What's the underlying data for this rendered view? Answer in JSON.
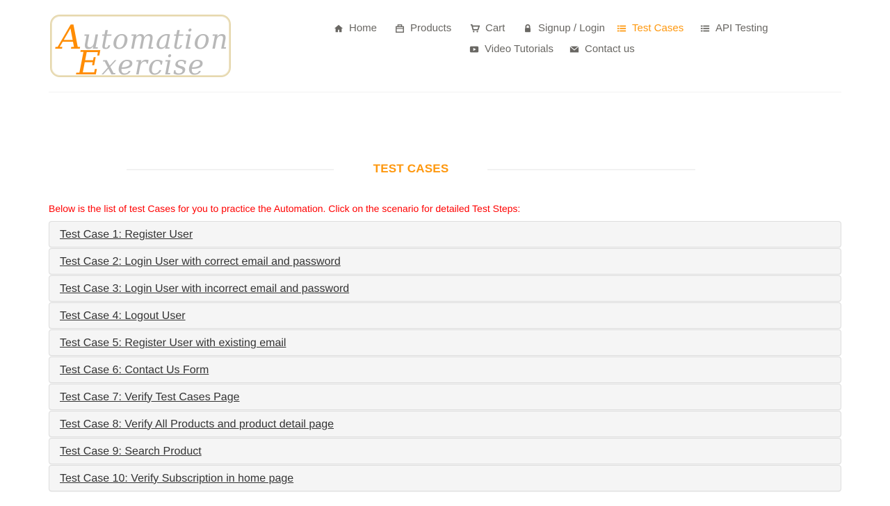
{
  "logo": {
    "line1_first": "A",
    "line1_rest": "utomation",
    "line2_first": "E",
    "line2_rest": "xercise"
  },
  "nav": [
    {
      "label": "Home",
      "icon": "home-icon"
    },
    {
      "label": "Products",
      "icon": "products-icon"
    },
    {
      "label": "Cart",
      "icon": "cart-icon"
    },
    {
      "label": "Signup / Login",
      "icon": "lock-icon"
    },
    {
      "label": "Test Cases",
      "icon": "list-icon",
      "active": true
    },
    {
      "label": "API Testing",
      "icon": "list-icon"
    },
    {
      "label": "Video Tutorials",
      "icon": "youtube-icon"
    },
    {
      "label": "Contact us",
      "icon": "envelope-icon"
    }
  ],
  "page": {
    "title": "TEST CASES",
    "intro": "Below is the list of test Cases for you to practice the Automation. Click on the scenario for detailed Test Steps:"
  },
  "test_cases": [
    "Test Case 1: Register User",
    "Test Case 2: Login User with correct email and password",
    "Test Case 3: Login User with incorrect email and password",
    "Test Case 4: Logout User",
    "Test Case 5: Register User with existing email",
    "Test Case 6: Contact Us Form",
    "Test Case 7: Verify Test Cases Page",
    "Test Case 8: Verify All Products and product detail page",
    "Test Case 9: Search Product",
    "Test Case 10: Verify Subscription in home page"
  ],
  "colors": {
    "accent": "#fe980f",
    "nav_text": "#696763",
    "intro_text": "#ff0000",
    "case_background": "#f5f5f5"
  }
}
